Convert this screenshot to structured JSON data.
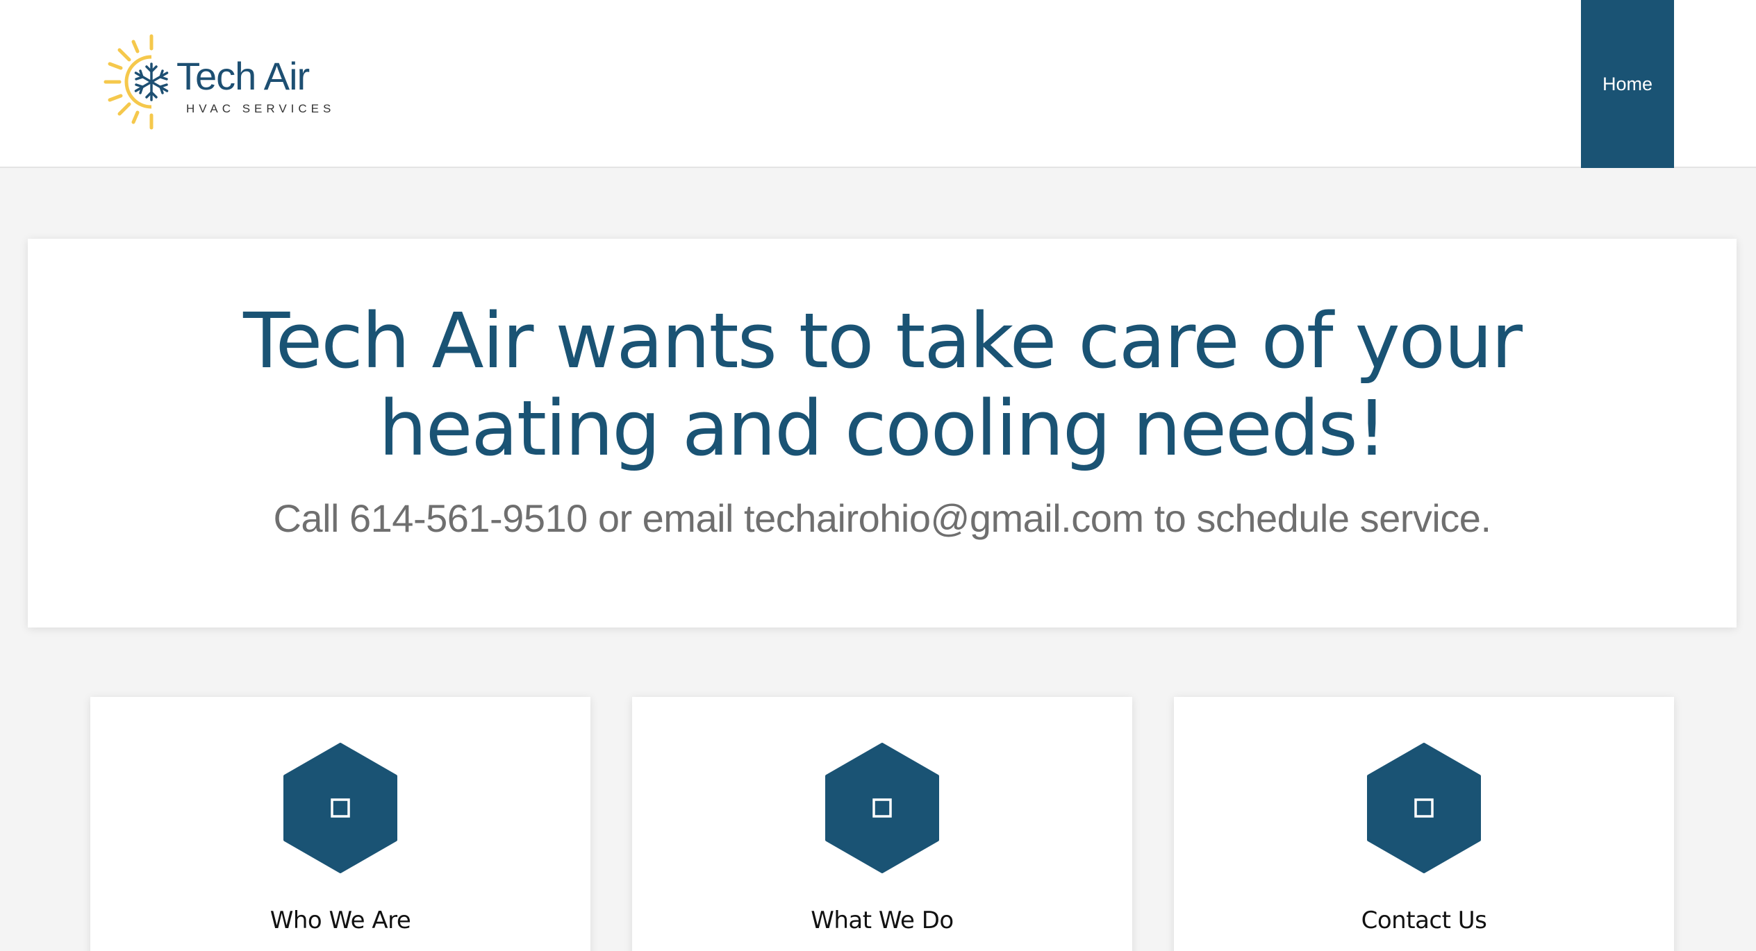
{
  "header": {
    "logo": {
      "name": "Tech Air",
      "tagline": "HVAC SERVICES",
      "icon": "snowflake-sun-icon"
    },
    "nav": [
      {
        "label": "Home"
      }
    ]
  },
  "hero": {
    "title": "Tech Air wants to take care of your heating and cooling needs!",
    "subtitle": "Call 614-561-9510 or email techairohio@gmail.com to schedule service."
  },
  "cards": [
    {
      "title": "Who We Are",
      "icon": "square-icon"
    },
    {
      "title": "What We Do",
      "icon": "square-icon"
    },
    {
      "title": "Contact Us",
      "icon": "square-icon"
    }
  ],
  "colors": {
    "brand": "#1a5374",
    "sun": "#f5c84c",
    "subtitle": "#6f6f6f"
  }
}
